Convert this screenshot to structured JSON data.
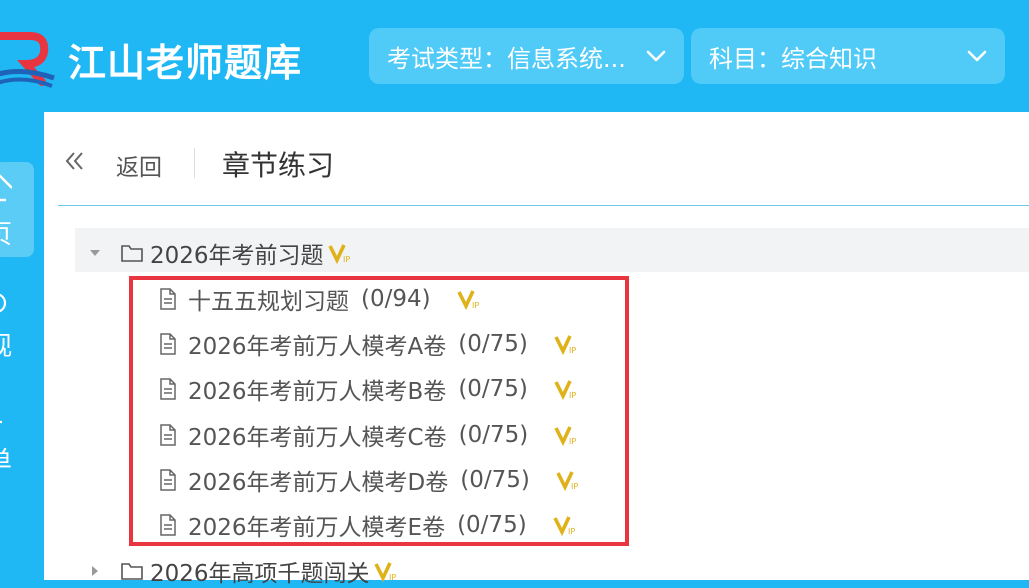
{
  "app": {
    "title": "江山老师题库"
  },
  "header": {
    "exam_type": "考试类型：信息系统...",
    "subject": "科目：综合知识"
  },
  "nav": {
    "items": [
      {
        "label": "页"
      },
      {
        "label": "观"
      },
      {
        "label": "单"
      }
    ]
  },
  "page": {
    "back_label": "返回",
    "title": "章节练习"
  },
  "tree": {
    "group1": {
      "label": "2026年考前习题",
      "expanded": true,
      "items": [
        {
          "label": "十五五规划习题",
          "count": "(0/94)"
        },
        {
          "label": "2026年考前万人模考A卷",
          "count": "(0/75)"
        },
        {
          "label": "2026年考前万人模考B卷",
          "count": "(0/75)"
        },
        {
          "label": "2026年考前万人模考C卷",
          "count": "(0/75)"
        },
        {
          "label": "2026年考前万人模考D卷",
          "count": "(0/75)"
        },
        {
          "label": "2026年考前万人模考E卷",
          "count": "(0/75)"
        }
      ]
    },
    "group2": {
      "label": "2026年高项千题闯关",
      "expanded": false
    }
  },
  "colors": {
    "header_bg": "#1FB8F5",
    "select_bg": "#50CAF7",
    "highlight_border": "#E8353F",
    "vip_gold": "#E0B21A"
  },
  "icons": [
    "logo-icon",
    "chevron-down-icon",
    "double-chevron-left-icon",
    "folder-icon",
    "document-icon",
    "vip-icon",
    "caret-down-icon",
    "caret-right-icon",
    "home-icon"
  ]
}
